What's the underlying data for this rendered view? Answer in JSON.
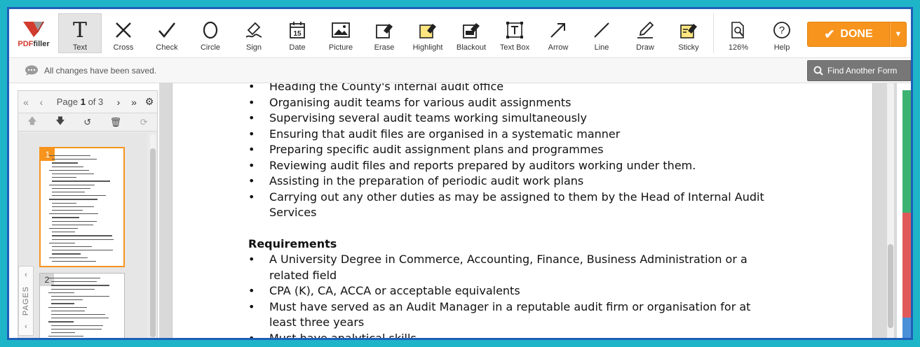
{
  "logo": {
    "brand_pdf": "PDF",
    "brand_rest": "filler"
  },
  "toolbar": {
    "tools": [
      {
        "name": "text",
        "label": "Text",
        "icon": "text-icon"
      },
      {
        "name": "cross",
        "label": "Cross",
        "icon": "cross-icon"
      },
      {
        "name": "check",
        "label": "Check",
        "icon": "check-icon"
      },
      {
        "name": "circle",
        "label": "Circle",
        "icon": "circle-icon"
      },
      {
        "name": "sign",
        "label": "Sign",
        "icon": "sign-icon"
      },
      {
        "name": "date",
        "label": "Date",
        "icon": "calendar-icon",
        "date_num": "15"
      },
      {
        "name": "picture",
        "label": "Picture",
        "icon": "picture-icon"
      },
      {
        "name": "erase",
        "label": "Erase",
        "icon": "eraser-icon"
      },
      {
        "name": "highlight",
        "label": "Highlight",
        "icon": "highlighter-icon"
      },
      {
        "name": "blackout",
        "label": "Blackout",
        "icon": "blackout-icon"
      },
      {
        "name": "textbox",
        "label": "Text Box",
        "icon": "textbox-icon"
      },
      {
        "name": "arrow",
        "label": "Arrow",
        "icon": "arrow-icon"
      },
      {
        "name": "line",
        "label": "Line",
        "icon": "line-icon"
      },
      {
        "name": "draw",
        "label": "Draw",
        "icon": "pen-icon"
      },
      {
        "name": "sticky",
        "label": "Sticky",
        "icon": "sticky-note-icon"
      }
    ],
    "zoom_label": "126%",
    "help_label": "Help",
    "done_label": "DONE"
  },
  "status": {
    "text": "All changes have been saved."
  },
  "find_button": {
    "label": "Find Another Form"
  },
  "pager": {
    "prefix": "Page",
    "current": "1",
    "of": "of 3"
  },
  "thumbnails": [
    {
      "num": "1"
    },
    {
      "num": "2"
    }
  ],
  "pages_tab": {
    "label": "PAGES"
  },
  "document": {
    "partial_top_line": "Heading the County's internal audit office",
    "duties": [
      "Organising audit teams for various audit assignments",
      "Supervising several audit teams working simultaneously",
      "Ensuring that audit files are organised in a systematic manner",
      "Preparing specific audit assignment plans and programmes",
      "Reviewing audit files and reports prepared by auditors working under them.",
      "Assisting in the preparation of periodic audit work plans",
      "Carrying out any other duties as may be assigned to them by the Head of Internal Audit Services"
    ],
    "requirements_heading": "Requirements",
    "requirements": [
      "A University Degree in Commerce, Accounting, Finance, Business Administration or a related field",
      "CPA (K), CA, ACCA or acceptable equivalents",
      "Must have served as an Audit Manager in a reputable audit firm or organisation for at least three years",
      "Must have analytical skills"
    ]
  },
  "colors": {
    "accent": "#f7941d",
    "frame": "#1e5fb8",
    "outer": "#1fb5c9"
  }
}
